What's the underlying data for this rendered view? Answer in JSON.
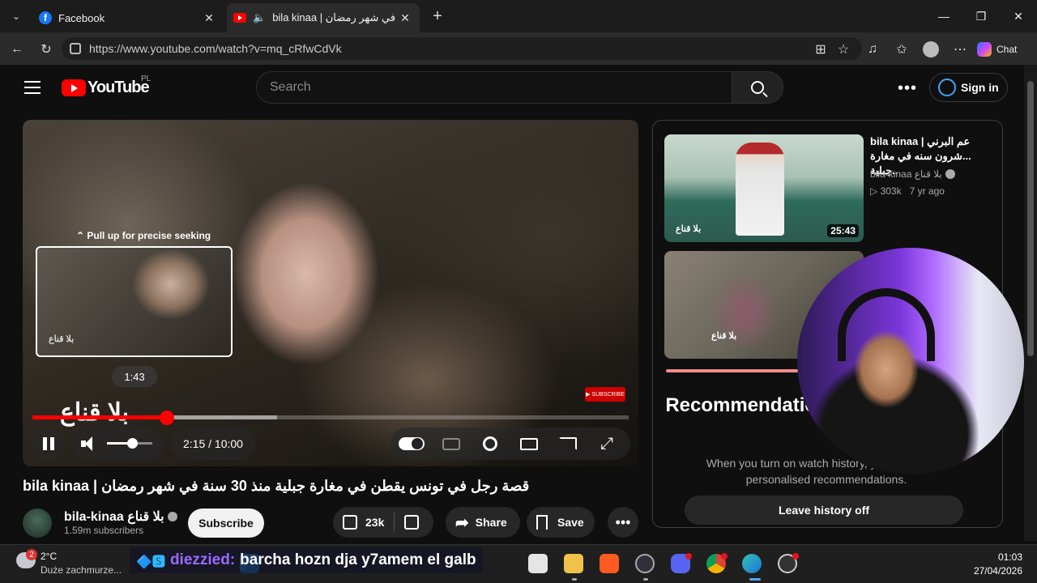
{
  "browser": {
    "tabs": [
      {
        "label": "Facebook",
        "active": false
      },
      {
        "label": "bila kinaa | قصة في شهر رمضان",
        "active": true
      }
    ],
    "url": "https://www.youtube.com/watch?v=mq_cRfwCdVk",
    "chat_label": "Chat"
  },
  "yt": {
    "logo_word": "YouTube",
    "country": "PL",
    "search_placeholder": "Search",
    "signin_label": "Sign in"
  },
  "player": {
    "preview_hint": "⌃ Pull up for precise seeking",
    "preview_watermark": "بلا قناع",
    "preview_time": "1:43",
    "big_watermark": "بلا قناع",
    "timecode": "2:15 / 10:00",
    "played_fraction": 0.225,
    "buffered_fraction": 0.41,
    "volume_fraction": 0.55
  },
  "video": {
    "title": "bila kinaa | قصة رجل في تونس يقطن في مغارة جبلية منذ 30 سنة في شهر رمضان",
    "channel": "bila-kinaa بلا قناع",
    "subscribers": "1.59m subscribers",
    "subscribe_label": "Subscribe",
    "likes": "23k",
    "share_label": "Share",
    "save_label": "Save"
  },
  "sidebar": {
    "rec1": {
      "title": "bila kinaa | عم البرني ...شرون سنه في مغارة جبلية..",
      "channel": "bila-kinaa بلا قناع",
      "views": "▷ 303k",
      "age": "7 yr ago",
      "duration": "25:43",
      "watermark": "بلا قناع"
    },
    "rec2": {
      "watermark": "بلا قناع"
    },
    "heading": "Recommendations not quite right?",
    "body": "When you turn on watch history, you'll see more personalised recommendations.",
    "leave_label": "Leave history off"
  },
  "taskbar": {
    "temp": "2°C",
    "weather": "Duże zachmurze...",
    "weather_badge": "2",
    "time": "01:03",
    "date": "27/04/2026"
  },
  "chat": {
    "badge": "🔷🆂",
    "user": "diezzied:",
    "message": "barcha hozn dja y7amem el galb"
  },
  "colors": {
    "yt_red": "#ff0000",
    "link_blue": "#3ea6ff",
    "background": "#0f0f0f"
  }
}
